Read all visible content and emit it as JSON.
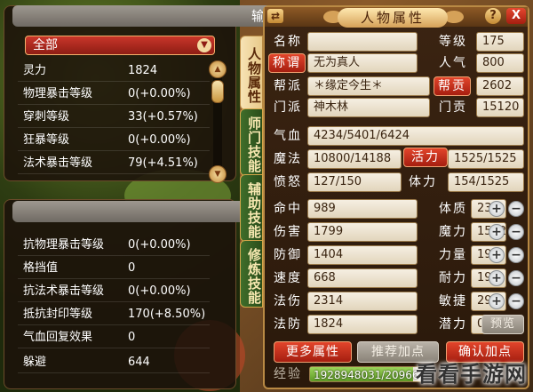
{
  "output_panel": {
    "title": "输出",
    "filter": "全部",
    "rows": [
      {
        "label": "灵力",
        "value": "1824"
      },
      {
        "label": "物理暴击等级",
        "value": "0(+0.00%)"
      },
      {
        "label": "穿刺等级",
        "value": "33(+0.57%)"
      },
      {
        "label": "狂暴等级",
        "value": "0(+0.00%)"
      },
      {
        "label": "法术暴击等级",
        "value": "79(+4.51%)"
      }
    ]
  },
  "resist_panel": {
    "title": "抗性",
    "rows": [
      {
        "label": "抗物理暴击等级",
        "value": "0(+0.00%)"
      },
      {
        "label": "格挡值",
        "value": "0"
      },
      {
        "label": "抗法术暴击等级",
        "value": "0(+0.00%)"
      },
      {
        "label": "抵抗封印等级",
        "value": "170(+8.50%)"
      },
      {
        "label": "气血回复效果",
        "value": "0"
      },
      {
        "label": "躲避",
        "value": "644"
      }
    ]
  },
  "side_tabs": [
    {
      "label": "人物属性",
      "active": true
    },
    {
      "label": "师门技能",
      "active": false
    },
    {
      "label": "辅助技能",
      "active": false
    },
    {
      "label": "修炼技能",
      "active": false
    }
  ],
  "attr_panel": {
    "title": "人物属性",
    "swap_icon": "⇄",
    "help_icon": "?",
    "close_icon": "X",
    "name_label": "名称",
    "level_label": "等级",
    "level": "175",
    "title_label": "称谓",
    "title_value": "无为真人",
    "popularity_label": "人气",
    "popularity": "800",
    "faction_label": "帮派",
    "faction": "＊缘定今生＊",
    "faction_contrib_label": "帮贡",
    "faction_contrib": "2602",
    "school_label": "门派",
    "school": "神木林",
    "school_contrib_label": "门贡",
    "school_contrib": "15120",
    "hp_label": "气血",
    "hp": "4234/5401/6424",
    "mp_label": "魔法",
    "mp": "10800/14188",
    "vitality_label": "活力",
    "vitality": "1525/1525",
    "anger_label": "愤怒",
    "anger": "127/150",
    "stamina_label": "体力",
    "stamina": "154/1525",
    "stats_left": [
      {
        "label": "命中",
        "value": "989"
      },
      {
        "label": "伤害",
        "value": "1799"
      },
      {
        "label": "防御",
        "value": "1404"
      },
      {
        "label": "速度",
        "value": "668"
      },
      {
        "label": "法伤",
        "value": "2314"
      },
      {
        "label": "法防",
        "value": "1824"
      }
    ],
    "stats_right": [
      {
        "label": "体质",
        "value": "232"
      },
      {
        "label": "魔力",
        "value": "1542"
      },
      {
        "label": "力量",
        "value": "199"
      },
      {
        "label": "耐力",
        "value": "199"
      },
      {
        "label": "敏捷",
        "value": "292"
      },
      {
        "label": "潜力",
        "value": "0"
      }
    ],
    "plus_icon": "+",
    "minus_icon": "−",
    "preview_label": "预览",
    "more_attrs_label": "更多属性",
    "recommend_label": "推荐加点",
    "confirm_label": "确认加点",
    "exp_label": "经验",
    "exp_value": "1928948031/20966",
    "exp_progress": 0.92
  },
  "watermark": "看看手游网",
  "colors": {
    "accent_red": "#a51e10",
    "gold": "#b98a44",
    "panel_dark": "#2a190b",
    "exp_green": "#5e9a26"
  }
}
